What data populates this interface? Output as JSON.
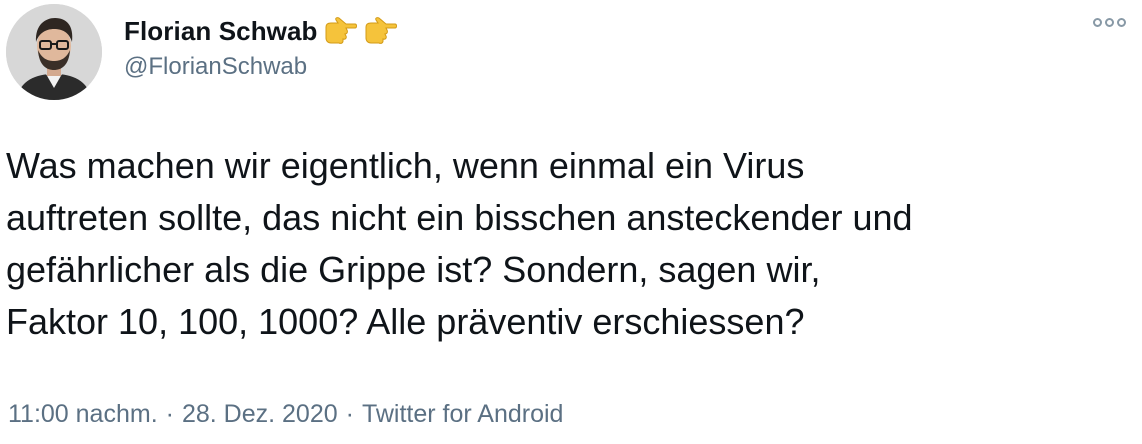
{
  "user": {
    "display_name": "Florian Schwab",
    "handle": "@FlorianSchwab",
    "name_emoji": [
      "pointing-right-emoji",
      "pointing-right-emoji"
    ]
  },
  "tweet": {
    "lines": [
      "Was machen wir eigentlich, wenn einmal ein Virus",
      "auftreten sollte, das nicht ein bisschen ansteckender und",
      "gefährlicher als die Grippe ist? Sondern, sagen wir,",
      "Faktor 10, 100, 1000? Alle präventiv erschiessen?"
    ]
  },
  "meta": {
    "time": "11:00 nachm.",
    "date": "28. Dez. 2020",
    "source": "Twitter for Android",
    "separator": "·"
  },
  "colors": {
    "text": "#0f1419",
    "secondary": "#5b7083",
    "emoji": "#f5c33b"
  }
}
